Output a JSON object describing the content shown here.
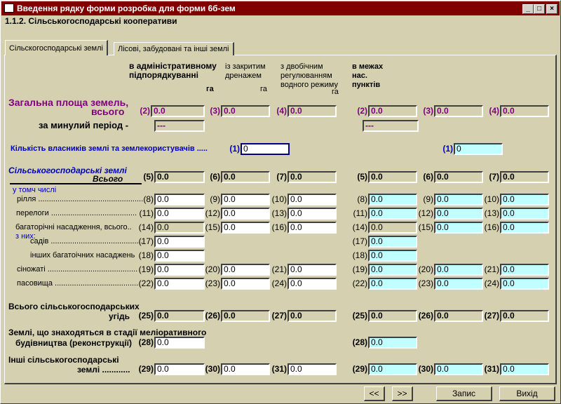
{
  "window": {
    "title": "Введення рядку форми розробка для форми 6б-зем",
    "subtitle": "1.1.2. Сільськогосподарські кооперативи",
    "min": "_",
    "max": "□",
    "close": "×"
  },
  "tabs": [
    {
      "label": "Сільскогосподарські землі",
      "active": true
    },
    {
      "label": "Лісові, забудовані та інші землі",
      "active": false
    }
  ],
  "headers": {
    "admin": "в адміністративному підпорядкуванні",
    "admin_unit": "га",
    "drain": "із закритим дренажем",
    "drain_unit": "га",
    "double": "з двобічним регулюванням водного режиму",
    "double_unit": "га",
    "settlements": "в межах нас. пунктів"
  },
  "labels": {
    "total_area": "Загальна площа земель,",
    "total_area2": "всього",
    "prev_period": "за минулий період -",
    "owners": "Кількість власників землі та землекористувачів .....",
    "agri_title": "Сільськогосподарські землі",
    "agri_total": "Всього",
    "incl": "у томч числі",
    "arable": "рілля .................................................",
    "fallow": "перелоги ........................................",
    "perennial": "багаторічні насадження,   всього..",
    "of_them": "з них:",
    "orchards": "садів ...........................................",
    "other_perennial": "інших багатоічних насаджень",
    "hayfields": "сіножаті ..........................................",
    "pastures": "пасовища .......................................",
    "total_agri": "Всього сільськогосподарських",
    "total_agri2": "угідь",
    "reclam": "Землі, що знаходяться в стадії меліоративного",
    "reclam2": "будівництва (реконструкції)",
    "other_agri": "Інші сільськогосподарські",
    "other_agri2": "землі ............"
  },
  "fields": {
    "r2a": {
      "num": "(2)",
      "value": "0.0"
    },
    "r2b": {
      "num": "(3)",
      "value": "0.0"
    },
    "r2c": {
      "num": "(4)",
      "value": "0.0"
    },
    "r2d": {
      "num": "(2)",
      "value": "0.0"
    },
    "r2e": {
      "num": "(3)",
      "value": "0.0"
    },
    "r2f": {
      "num": "(4)",
      "value": "0.0"
    },
    "pa": {
      "num": "",
      "value": "---"
    },
    "pd": {
      "num": "",
      "value": "---"
    },
    "r1a": {
      "num": "(1)",
      "value": "0"
    },
    "r1d": {
      "num": "(1)",
      "value": "0"
    },
    "r5a": {
      "num": "(5)",
      "value": "0.0"
    },
    "r5b": {
      "num": "(6)",
      "value": "0.0"
    },
    "r5c": {
      "num": "(7)",
      "value": "0.0"
    },
    "r5d": {
      "num": "(5)",
      "value": "0.0"
    },
    "r5e": {
      "num": "(6)",
      "value": "0.0"
    },
    "r5f": {
      "num": "(7)",
      "value": "0.0"
    },
    "r8a": {
      "num": "(8)",
      "value": "0.0"
    },
    "r8b": {
      "num": "(9)",
      "value": "0.0"
    },
    "r8c": {
      "num": "(10)",
      "value": "0.0"
    },
    "r8d": {
      "num": "(8)",
      "value": "0.0"
    },
    "r8e": {
      "num": "(9)",
      "value": "0.0"
    },
    "r8f": {
      "num": "(10)",
      "value": "0.0"
    },
    "r11a": {
      "num": "(11)",
      "value": "0.0"
    },
    "r11b": {
      "num": "(12)",
      "value": "0.0"
    },
    "r11c": {
      "num": "(13)",
      "value": "0.0"
    },
    "r11d": {
      "num": "(11)",
      "value": "0.0"
    },
    "r11e": {
      "num": "(12)",
      "value": "0.0"
    },
    "r11f": {
      "num": "(13)",
      "value": "0.0"
    },
    "r14a": {
      "num": "(14)",
      "value": "0.0"
    },
    "r14b": {
      "num": "(15)",
      "value": "0.0"
    },
    "r14c": {
      "num": "(16)",
      "value": "0.0"
    },
    "r14d": {
      "num": "(14)",
      "value": "0.0"
    },
    "r14e": {
      "num": "(15)",
      "value": "0.0"
    },
    "r14f": {
      "num": "(16)",
      "value": "0.0"
    },
    "r17a": {
      "num": "(17)",
      "value": "0.0"
    },
    "r17d": {
      "num": "(17)",
      "value": "0.0"
    },
    "r18a": {
      "num": "(18)",
      "value": "0.0"
    },
    "r18d": {
      "num": "(18)",
      "value": "0.0"
    },
    "r19a": {
      "num": "(19)",
      "value": "0.0"
    },
    "r19b": {
      "num": "(20)",
      "value": "0.0"
    },
    "r19c": {
      "num": "(21)",
      "value": "0.0"
    },
    "r19d": {
      "num": "(19)",
      "value": "0.0"
    },
    "r19e": {
      "num": "(20)",
      "value": "0.0"
    },
    "r19f": {
      "num": "(21)",
      "value": "0.0"
    },
    "r22a": {
      "num": "(22)",
      "value": "0.0"
    },
    "r22b": {
      "num": "(23)",
      "value": "0.0"
    },
    "r22c": {
      "num": "(24)",
      "value": "0.0"
    },
    "r22d": {
      "num": "(22)",
      "value": "0.0"
    },
    "r22e": {
      "num": "(23)",
      "value": "0.0"
    },
    "r22f": {
      "num": "(24)",
      "value": "0.0"
    },
    "r25a": {
      "num": "(25)",
      "value": "0.0"
    },
    "r25b": {
      "num": "(26)",
      "value": "0.0"
    },
    "r25c": {
      "num": "(27)",
      "value": "0.0"
    },
    "r25d": {
      "num": "(25)",
      "value": "0.0"
    },
    "r25e": {
      "num": "(26)",
      "value": "0.0"
    },
    "r25f": {
      "num": "(27)",
      "value": "0.0"
    },
    "r28a": {
      "num": "(28)",
      "value": "0.0"
    },
    "r28d": {
      "num": "(28)",
      "value": "0.0"
    },
    "r29a": {
      "num": "(29)",
      "value": "0.0"
    },
    "r29b": {
      "num": "(30)",
      "value": "0.0"
    },
    "r29c": {
      "num": "(31)",
      "value": "0.0"
    },
    "r29d": {
      "num": "(29)",
      "value": "0.0"
    },
    "r29e": {
      "num": "(30)",
      "value": "0.0"
    },
    "r29f": {
      "num": "(31)",
      "value": "0.0"
    }
  },
  "buttons": {
    "prev": "<<",
    "next": ">>",
    "save": "Запис",
    "exit": "Вихід"
  },
  "colors": {
    "title_bg": "#800000",
    "accent_purple": "#800080",
    "accent_blue": "#0000c0",
    "editable_cyan": "#c0ffff"
  }
}
